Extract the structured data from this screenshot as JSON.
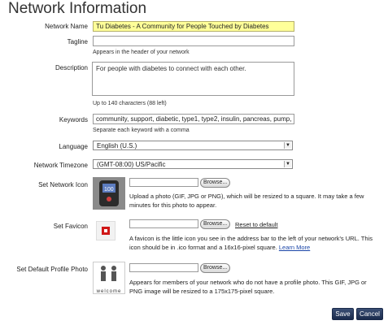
{
  "page_title": "Network Information",
  "network_name": {
    "label": "Network Name",
    "value": "Tu Diabetes - A Community for People Touched by Diabetes"
  },
  "tagline": {
    "label": "Tagline",
    "value": "",
    "hint": "Appears in the header of your network"
  },
  "description": {
    "label": "Description",
    "value": "For people with diabetes to connect with each other.",
    "hint": "Up to 140 characters (88 left)"
  },
  "keywords": {
    "label": "Keywords",
    "value": "community, support, diabetic, type1, type2, insulin, pancreas, pump, glucose",
    "hint": "Separate each keyword with a comma"
  },
  "language": {
    "label": "Language",
    "value": "English (U.S.)"
  },
  "timezone": {
    "label": "Network Timezone",
    "value": "(GMT-08:00) US/Pacific"
  },
  "network_icon": {
    "label": "Set Network Icon",
    "browse": "Browse...",
    "desc_lines": [
      "Upload a photo (GIF, JPG or PNG), which will be resized to a square. It may take a few",
      "minutes for this photo to appear."
    ]
  },
  "favicon": {
    "label": "Set Favicon",
    "browse": "Browse...",
    "reset": "Reset to default",
    "desc_lines": [
      "A favicon is the little icon you see in the address bar to the left of your network's URL. This"
    ],
    "desc_line2": "icon should be in .ico format and a 16x16-pixel square.",
    "learn_more": "Learn More"
  },
  "profile_photo": {
    "label": "Set Default Profile Photo",
    "browse": "Browse...",
    "thumb_text": "welcome",
    "desc_lines": [
      "Appears for members of your network who do not have a profile photo. This GIF, JPG or",
      "PNG image will be resized to a 175x175-pixel square."
    ]
  },
  "buttons": {
    "save": "Save",
    "cancel": "Cancel"
  },
  "colors": {
    "highlight": "#ffff99",
    "button": "#1f3050",
    "link": "#1a45a8"
  }
}
